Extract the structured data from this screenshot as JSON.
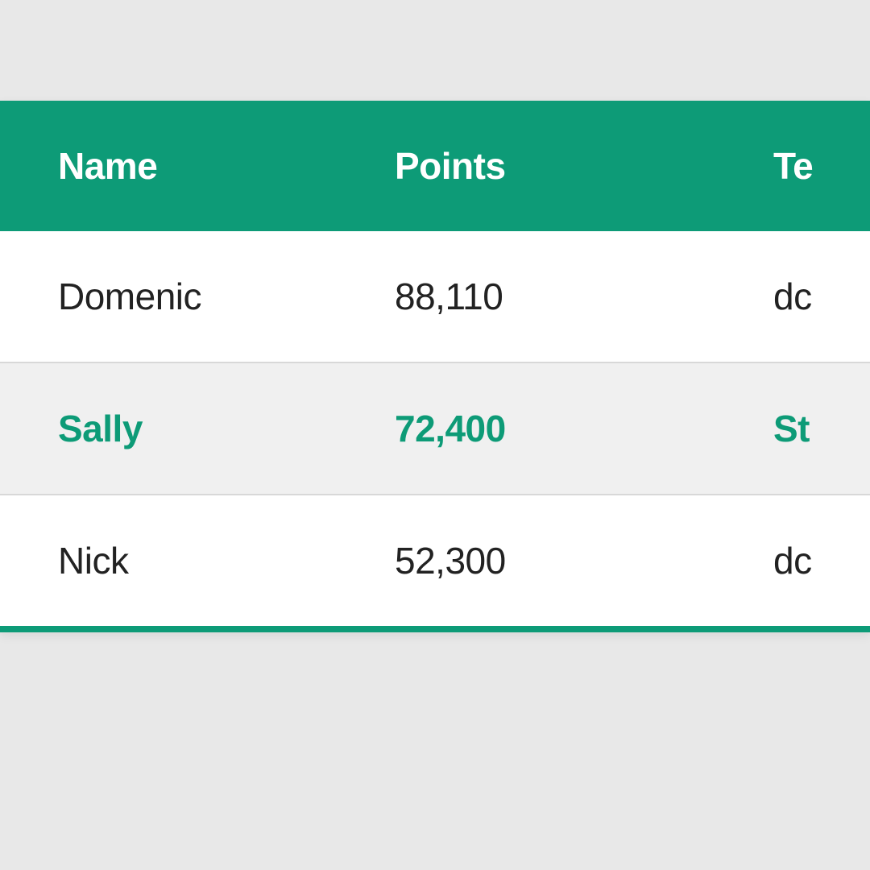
{
  "table": {
    "headers": {
      "name": "Name",
      "points": "Points",
      "team": "Te"
    },
    "rows": [
      {
        "name": "Domenic",
        "points": "88,110",
        "team": "dc",
        "highlighted": false
      },
      {
        "name": "Sally",
        "points": "72,400",
        "team": "St",
        "highlighted": true
      },
      {
        "name": "Nick",
        "points": "52,300",
        "team": "dc",
        "highlighted": false
      }
    ]
  },
  "colors": {
    "accent": "#0d9b77",
    "rowHighlight": "#f0f0f0"
  }
}
